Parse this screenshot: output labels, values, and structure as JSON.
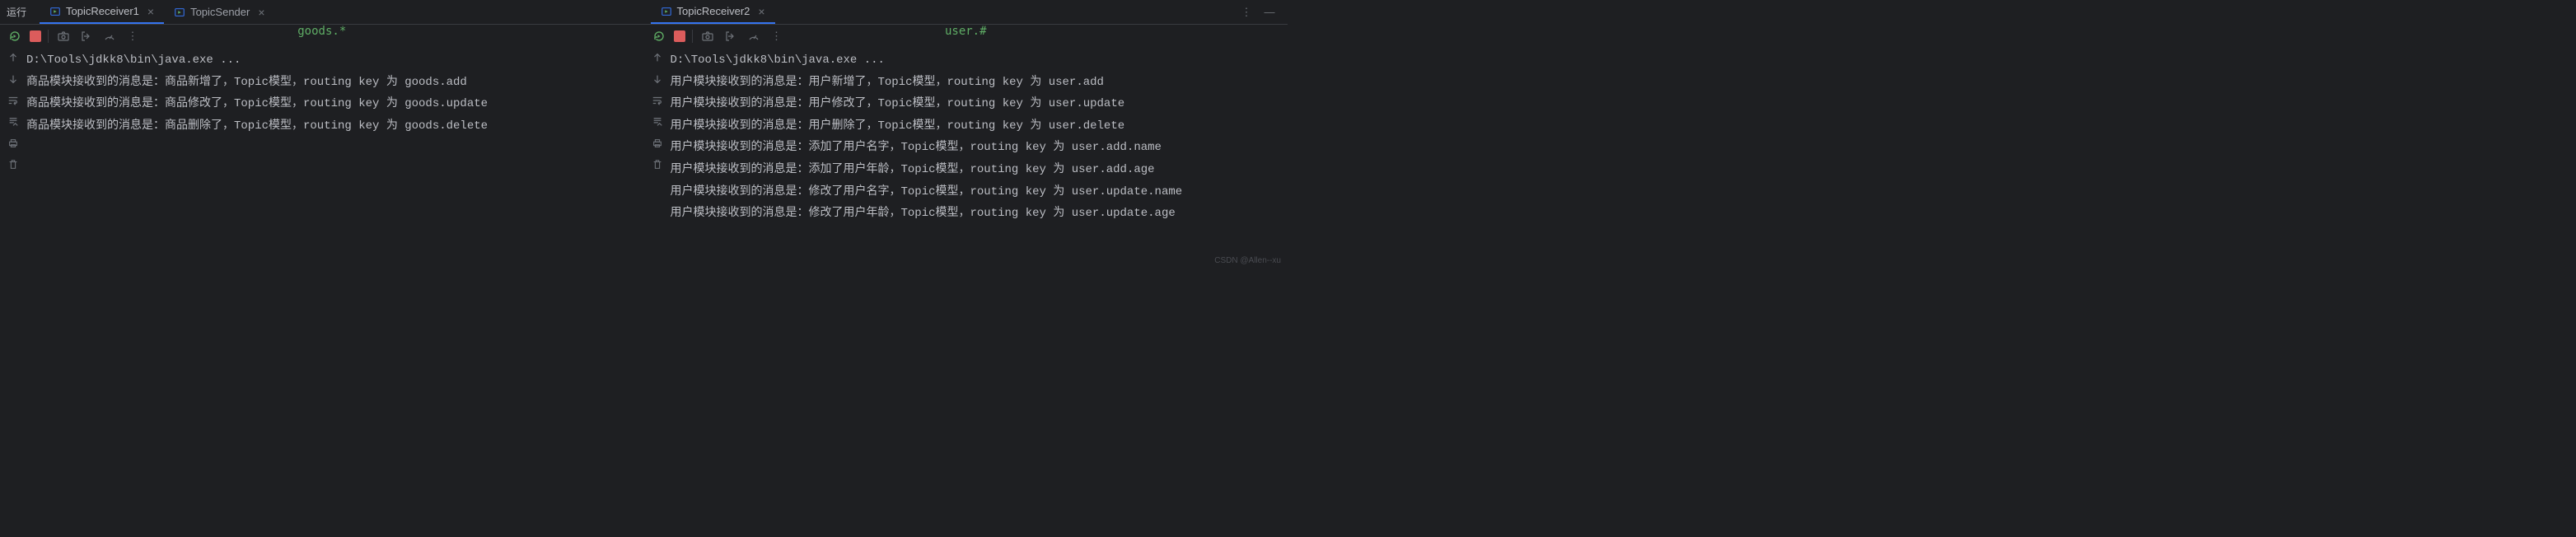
{
  "left": {
    "runLabel": "运行",
    "tabs": [
      {
        "label": "TopicReceiver1",
        "active": true
      },
      {
        "label": "TopicSender",
        "active": false
      }
    ],
    "annotation": "goods.*",
    "console": [
      "D:\\Tools\\jdkk8\\bin\\java.exe ...",
      "商品模块接收到的消息是：商品新增了，Topic模型，routing key 为 goods.add",
      "商品模块接收到的消息是：商品修改了，Topic模型，routing key 为 goods.update",
      "商品模块接收到的消息是：商品删除了，Topic模型，routing key 为 goods.delete"
    ]
  },
  "right": {
    "tabs": [
      {
        "label": "TopicReceiver2",
        "active": true
      }
    ],
    "annotation": "user.#",
    "console": [
      "D:\\Tools\\jdkk8\\bin\\java.exe ...",
      "用户模块接收到的消息是：用户新增了，Topic模型，routing key 为 user.add",
      "用户模块接收到的消息是：用户修改了，Topic模型，routing key 为 user.update",
      "用户模块接收到的消息是：用户删除了，Topic模型，routing key 为 user.delete",
      "用户模块接收到的消息是：添加了用户名字，Topic模型，routing key 为 user.add.name",
      "用户模块接收到的消息是：添加了用户年龄，Topic模型，routing key 为 user.add.age",
      "用户模块接收到的消息是：修改了用户名字，Topic模型，routing key 为 user.update.name",
      "用户模块接收到的消息是：修改了用户年龄，Topic模型，routing key 为 user.update.age"
    ]
  },
  "watermark": "CSDN @Allen--xu"
}
